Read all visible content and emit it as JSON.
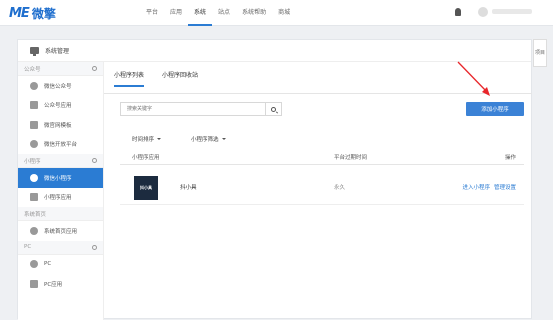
{
  "header": {
    "logo_mark": "ME",
    "logo_text": "微擎",
    "nav": [
      "平台",
      "应用",
      "系统",
      "站点",
      "系统帮助",
      "商城"
    ],
    "active_nav_index": 2
  },
  "panel": {
    "title": "系统管理"
  },
  "sidebar": {
    "groups": [
      {
        "label": "公众号",
        "items": [
          {
            "label": "微信公众号",
            "icon": "wechat-icon"
          },
          {
            "label": "公众号应用",
            "icon": "app-icon"
          },
          {
            "label": "微官网模板",
            "icon": "template-icon"
          },
          {
            "label": "微信开放平台",
            "icon": "open-platform-icon"
          }
        ]
      },
      {
        "label": "小程序",
        "items": [
          {
            "label": "微信小程序",
            "icon": "miniprogram-icon",
            "active": true
          },
          {
            "label": "小程序应用",
            "icon": "app-icon"
          }
        ]
      },
      {
        "label": "系统首页",
        "items": [
          {
            "label": "系统首页应用",
            "icon": "home-icon"
          }
        ]
      },
      {
        "label": "PC",
        "items": [
          {
            "label": "PC",
            "icon": "pc-icon"
          },
          {
            "label": "PC应用",
            "icon": "app-icon"
          }
        ]
      }
    ]
  },
  "tabs": [
    "小程序列表",
    "小程序回收站"
  ],
  "search": {
    "placeholder": "搜索关键字"
  },
  "add_button": "添加小程序",
  "filters": [
    "时间排序",
    "小程序筛选"
  ],
  "table": {
    "columns": [
      "小程序应用",
      "平台过期时间",
      "操作"
    ],
    "rows": [
      {
        "thumb_text": "抖小具",
        "name": "抖小具",
        "expire": "永久",
        "actions": [
          "进入小程序",
          "管理设置"
        ]
      }
    ]
  },
  "right_tab": "项目"
}
